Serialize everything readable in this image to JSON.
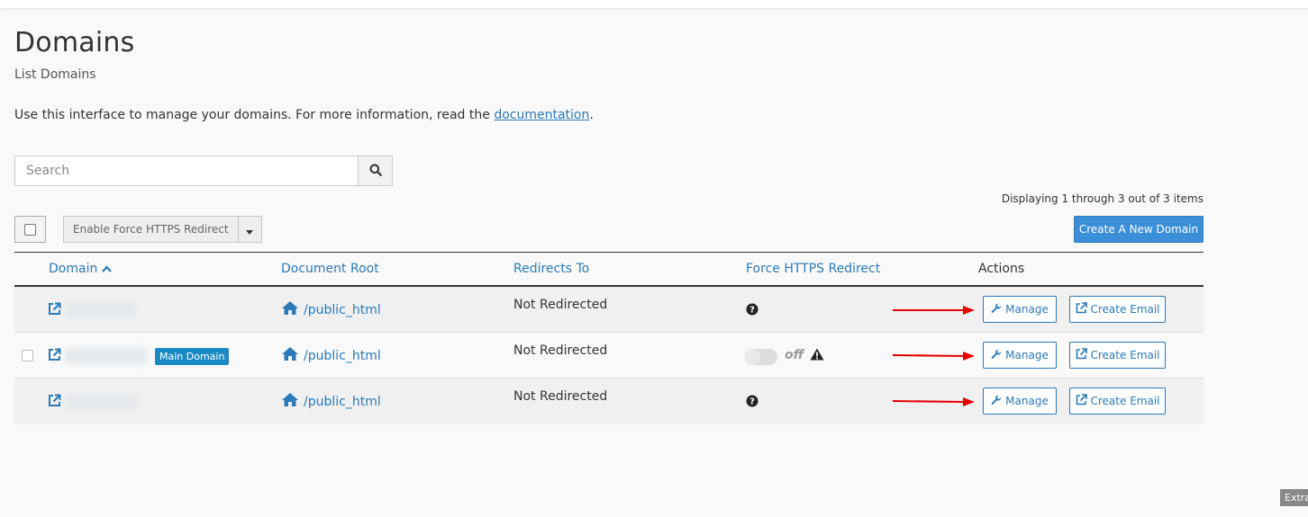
{
  "header": {
    "title": "Domains",
    "subtitle": "List Domains",
    "intro_text": "Use this interface to manage your domains. For more information, read the ",
    "intro_link": "documentation",
    "intro_end": "."
  },
  "search": {
    "placeholder": "Search"
  },
  "pagination": {
    "status": "Displaying 1 through 3 out of 3 items"
  },
  "toolbar": {
    "bulk_action": "Enable Force HTTPS Redirect",
    "create_label": "Create A New Domain"
  },
  "table": {
    "columns": {
      "domain": "Domain",
      "document_root": "Document Root",
      "redirects_to": "Redirects To",
      "force_https": "Force HTTPS Redirect",
      "actions": "Actions"
    },
    "rows": [
      {
        "document_root": "/public_html",
        "redirects_to": "Not Redirected",
        "manage": "Manage",
        "create_email": "Create Email"
      },
      {
        "badge": "Main Domain",
        "document_root": "/public_html",
        "redirects_to": "Not Redirected",
        "https_state": "off",
        "manage": "Manage",
        "create_email": "Create Email"
      },
      {
        "document_root": "/public_html",
        "redirects_to": "Not Redirected",
        "manage": "Manage",
        "create_email": "Create Email"
      }
    ]
  },
  "footer": {
    "extra_tab": "Extra"
  },
  "colors": {
    "link": "#2a7ab9",
    "primary_button": "#3b8fd8",
    "badge": "#1a8ac6",
    "annotation_arrow": "#e60000"
  },
  "icons": [
    "search-icon",
    "caret-down-icon",
    "sort-up-icon",
    "external-link-icon",
    "home-icon",
    "question-circle-icon",
    "warning-icon",
    "wrench-icon",
    "share-icon"
  ]
}
